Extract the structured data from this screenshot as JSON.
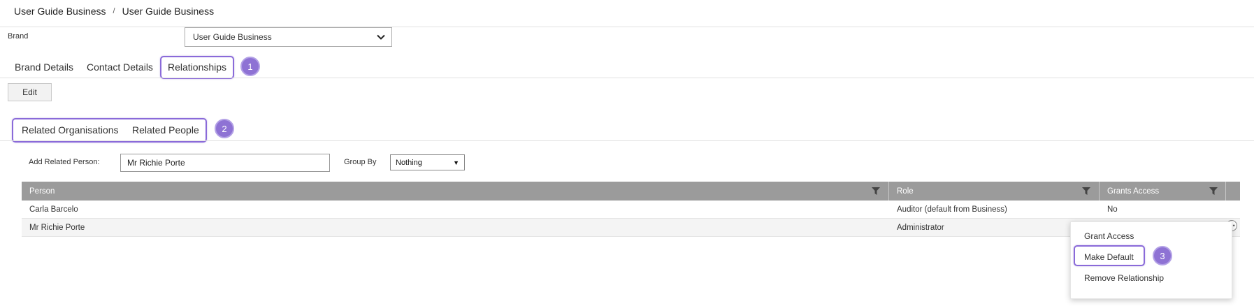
{
  "breadcrumb": {
    "items": [
      "User Guide Business",
      "User Guide Business"
    ],
    "separator": "/"
  },
  "brand": {
    "label": "Brand",
    "selected": "User Guide Business"
  },
  "tabs": [
    {
      "label": "Brand Details"
    },
    {
      "label": "Contact Details"
    },
    {
      "label": "Relationships",
      "active": true
    }
  ],
  "toolbar": {
    "edit_label": "Edit"
  },
  "subtabs": [
    {
      "label": "Related Organisations"
    },
    {
      "label": "Related People"
    }
  ],
  "form": {
    "add_person_label": "Add Related Person:",
    "add_person_value": "Mr Richie Porte",
    "group_by_label": "Group By",
    "group_by_value": "Nothing"
  },
  "table": {
    "columns": [
      "Person",
      "Role",
      "Grants Access"
    ],
    "rows": [
      {
        "person": "Carla Barcelo",
        "role": "Auditor (default from Business)",
        "grants_access": "No"
      },
      {
        "person": "Mr Richie Porte",
        "role": "Administrator",
        "grants_access": ""
      }
    ],
    "header_color": "#9b9b9b"
  },
  "context_menu": {
    "items": [
      "Grant Access",
      "Make Default",
      "Remove Relationship"
    ]
  },
  "annotations": {
    "steps": [
      "1",
      "2",
      "3"
    ],
    "color": "#8e72d4"
  },
  "icons": {
    "dropdown": "chevron-down-icon",
    "filter": "filter-icon",
    "row_menu": "more-options-icon"
  }
}
